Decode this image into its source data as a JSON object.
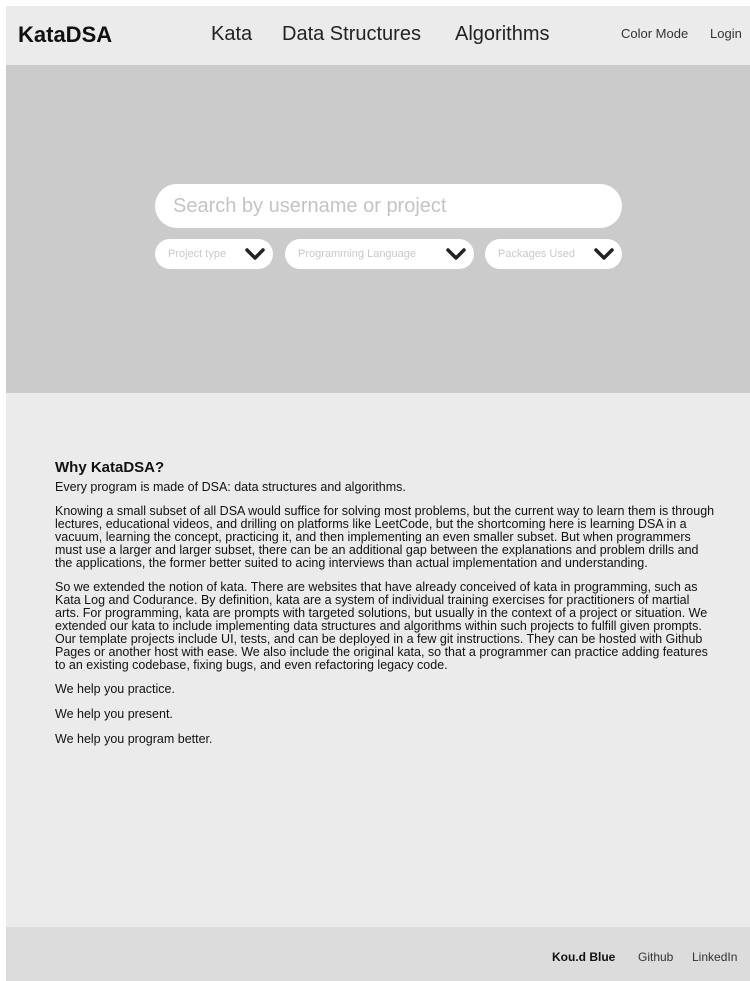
{
  "header": {
    "brand": "KataDSA",
    "nav": [
      "Kata",
      "Data Structures",
      "Algorithms"
    ],
    "color_mode": "Color Mode",
    "login": "Login"
  },
  "hero": {
    "search_placeholder": "Search by username or project",
    "filters": [
      "Project type",
      "Programming Language",
      "Packages Used"
    ],
    "filter_icon": "chevron-down-icon"
  },
  "about": {
    "title": "Why KataDSA?",
    "paragraphs": [
      "Every program is made of DSA: data structures and algorithms.",
      "Knowing a small subset of all DSA would suffice for solving most problems, but the current way to learn them is through lectures, educational videos, and drilling on platforms like LeetCode, but the shortcoming here is learning DSA in a vacuum, learning the concept, practicing it, and then implementing an even smaller subset. But when programmers must use a larger and larger subset, there can be an additional gap between the explanations and problem drills and the applications, the former better suited to acing interviews than actual implementation and understanding.",
      "So we extended the notion of kata. There are websites that have already conceived of kata in programming, such as Kata Log and Codurance. By definition, kata are a system of individual training exercises for practitioners of martial arts. For programming, kata are prompts with targeted solutions, but usually in the context of a project or situation. We extended our kata to include implementing data structures and algorithms within such projects to fulfill given prompts. Our template projects include UI, tests, and can be deployed in a few git instructions. They can be hosted with Github Pages or another host with ease. We also include the original kata, so that a programmer can practice adding features to an existing codebase, fixing bugs, and even refactoring legacy code.",
      "We help you practice.",
      "We help you present.",
      "We help you program better."
    ]
  },
  "footer": {
    "brand": "Kou.d Blue",
    "links": [
      "Github",
      "LinkedIn"
    ]
  },
  "colors": {
    "header_bg": "#ebebeb",
    "hero_bg": "#cbcbcb",
    "footer_bg": "#dcdcdc",
    "input_bg": "#ffffff"
  }
}
